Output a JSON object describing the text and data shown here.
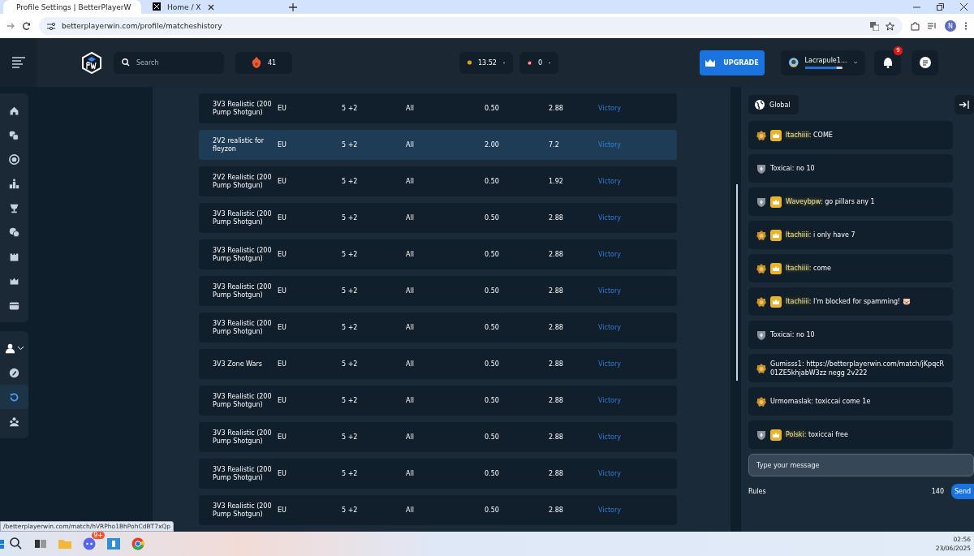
{
  "browser": {
    "tabs": [
      {
        "title": "Profile Settings | BetterPlayerW",
        "selected": true
      },
      {
        "title": "Home / X",
        "selected": false
      }
    ],
    "address": "betterplayerwin.com/profile/matcheshistory",
    "profile_initial": "N"
  },
  "header": {
    "search_placeholder": "Search",
    "flames": "41",
    "coins": "13.52",
    "targets": "0",
    "upgrade": "UPGRADE",
    "username": "Lacrapule1...",
    "xp": {
      "level": 0.85
    },
    "notifications": "9"
  },
  "sidebar": {
    "items": [
      {
        "selected": false
      },
      {
        "selected": false
      },
      {
        "selected": false
      },
      {
        "selected": false
      },
      {
        "selected": false
      },
      {
        "selected": false
      },
      {
        "selected": false
      },
      {
        "selected": false
      },
      {
        "selected": false
      }
    ],
    "profile_items": [
      {
        "kind": "dropdown",
        "selected": false
      },
      {
        "kind": "link",
        "selected": false
      },
      {
        "kind": "link",
        "selected": true
      },
      {
        "kind": "link",
        "selected": false
      }
    ]
  },
  "matches": {
    "rows": [
      {
        "title": "3V3 Realistic (200 Pump Shotgun)",
        "region": "EU",
        "column_3": "5 +2",
        "column_4": "All",
        "column_5": "0.50",
        "column_6": "2.88",
        "result": "Victory",
        "selected": false
      },
      {
        "title": "2V2 realistic for fleyzon",
        "region": "EU",
        "column_3": "5 +2",
        "column_4": "All",
        "column_5": "2.00",
        "column_6": "7.2",
        "result": "Victory",
        "selected": true
      },
      {
        "title": "2V2 Realistic (200 Pump Shotgun)",
        "region": "EU",
        "column_3": "5 +2",
        "column_4": "All",
        "column_5": "0.50",
        "column_6": "1.92",
        "result": "Victory",
        "selected": false
      },
      {
        "title": "3V3 Realistic (200 Pump Shotgun)",
        "region": "EU",
        "column_3": "5 +2",
        "column_4": "All",
        "column_5": "0.50",
        "column_6": "2.88",
        "result": "Victory",
        "selected": false
      },
      {
        "title": "3V3 Realistic (200 Pump Shotgun)",
        "region": "EU",
        "column_3": "5 +2",
        "column_4": "All",
        "column_5": "0.50",
        "column_6": "2.88",
        "result": "Victory",
        "selected": false
      },
      {
        "title": "3V3 Realistic (200 Pump Shotgun)",
        "region": "EU",
        "column_3": "5 +2",
        "column_4": "All",
        "column_5": "0.50",
        "column_6": "2.88",
        "result": "Victory",
        "selected": false
      },
      {
        "title": "3V3 Realistic (200 Pump Shotgun)",
        "region": "EU",
        "column_3": "5 +2",
        "column_4": "All",
        "column_5": "0.50",
        "column_6": "2.88",
        "result": "Victory",
        "selected": false
      },
      {
        "title": "3V3 Zone Wars",
        "region": "EU",
        "column_3": "5 +2",
        "column_4": "All",
        "column_5": "0.50",
        "column_6": "2.88",
        "result": "Victory",
        "selected": false
      },
      {
        "title": "3V3 Realistic (200 Pump Shotgun)",
        "region": "EU",
        "column_3": "5 +2",
        "column_4": "All",
        "column_5": "0.50",
        "column_6": "2.88",
        "result": "Victory",
        "selected": false
      },
      {
        "title": "3V3 Realistic (200 Pump Shotgun)",
        "region": "EU",
        "column_3": "5 +2",
        "column_4": "All",
        "column_5": "0.50",
        "column_6": "2.88",
        "result": "Victory",
        "selected": false
      },
      {
        "title": "3V3 Realistic (200 Pump Shotgun)",
        "region": "EU",
        "column_3": "5 +2",
        "column_4": "All",
        "column_5": "0.50",
        "column_6": "2.88",
        "result": "Victory",
        "selected": false
      },
      {
        "title": "3V3 Realistic (200 Pump Shotgun)",
        "region": "EU",
        "column_3": "5 +2",
        "column_4": "All",
        "column_5": "0.50",
        "column_6": "2.88",
        "result": "Victory",
        "selected": false
      }
    ]
  },
  "chat": {
    "channel": "Global",
    "messages": [
      {
        "kind": "medal",
        "vip": true,
        "author": "Itachiiii:",
        "text": "COME"
      },
      {
        "kind": "shield",
        "vip": false,
        "author": "Toxicai:",
        "text": "no 10"
      },
      {
        "kind": "shield",
        "vip": true,
        "author": "Waveybpw:",
        "text": "go pillars any 1"
      },
      {
        "kind": "medal",
        "vip": true,
        "author": "Itachiiii:",
        "text": "i only have 7"
      },
      {
        "kind": "medal",
        "vip": true,
        "author": "Itachiiii:",
        "text": "come"
      },
      {
        "kind": "medal",
        "vip": true,
        "author": "Itachiiii:",
        "text": "I'm blocked for spamming! 🐷"
      },
      {
        "kind": "shield",
        "vip": false,
        "author": "Toxicai:",
        "text": "no 10"
      },
      {
        "kind": "medal",
        "vip": false,
        "author": "Gumisss1:",
        "text": "https://betterplayerwin.com/match/jKpqcR01ZE5khjabW3zz negg 2v222"
      },
      {
        "kind": "medal",
        "vip": false,
        "author": "Urmomaslak:",
        "text": "toxiccai come 1e"
      },
      {
        "kind": "shield",
        "vip": true,
        "author": "Polski:",
        "text": "toxiccai free"
      }
    ],
    "input_placeholder": "Type your message",
    "rules": "Rules",
    "char_count": "140",
    "send": "Send"
  },
  "status_link": "/betterplayerwin.com/match/hVRPho1BhPohCdBT7xQp",
  "taskbar": {
    "chat_app_badge": "9+",
    "time": "02:56",
    "date": "23/06/2025"
  }
}
